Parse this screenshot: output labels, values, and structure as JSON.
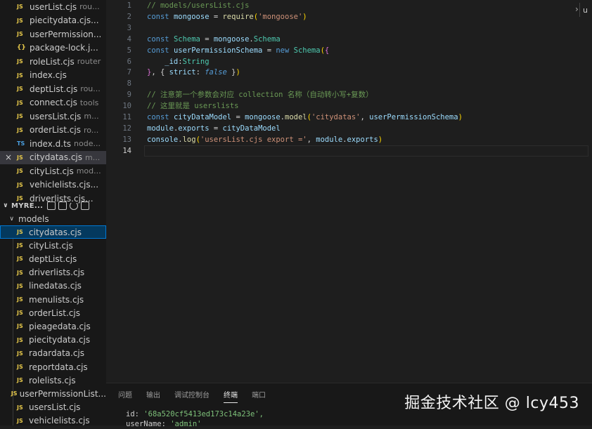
{
  "open_editors": [
    {
      "name": "userList.cjs",
      "desc": "rou...",
      "icon": "JS"
    },
    {
      "name": "piecitydata.cjs...",
      "desc": "",
      "icon": "JS"
    },
    {
      "name": "userPermission...",
      "desc": "",
      "icon": "JS"
    },
    {
      "name": "package-lock.j...",
      "desc": "",
      "icon": "{}"
    },
    {
      "name": "roleList.cjs",
      "desc": "router",
      "icon": "JS"
    },
    {
      "name": "index.cjs",
      "desc": "",
      "icon": "JS"
    },
    {
      "name": "deptList.cjs",
      "desc": "rou...",
      "icon": "JS"
    },
    {
      "name": "connect.cjs",
      "desc": "tools",
      "icon": "JS"
    },
    {
      "name": "usersList.cjs",
      "desc": "m...",
      "icon": "JS"
    },
    {
      "name": "orderList.cjs",
      "desc": "ro...",
      "icon": "JS"
    },
    {
      "name": "index.d.ts",
      "desc": "node...",
      "icon": "TS"
    },
    {
      "name": "citydatas.cjs",
      "desc": "m...",
      "icon": "JS",
      "close": "×",
      "active": true
    },
    {
      "name": "cityList.cjs",
      "desc": "mod...",
      "icon": "JS"
    },
    {
      "name": "vehiclelists.cjs...",
      "desc": "",
      "icon": "JS"
    },
    {
      "name": "driverlists.cjs...",
      "desc": "",
      "icon": "JS"
    }
  ],
  "explorer": {
    "root_label": "MYRE...",
    "folder_label": "models",
    "files": [
      "citydatas.cjs",
      "cityList.cjs",
      "deptList.cjs",
      "driverlists.cjs",
      "linedatas.cjs",
      "menulists.cjs",
      "orderList.cjs",
      "pieagedata.cjs",
      "piecitydata.cjs",
      "radardata.cjs",
      "reportdata.cjs",
      "rolelists.cjs",
      "userPermissionList...",
      "usersList.cjs",
      "vehiclelists.cjs"
    ],
    "file_icon": "JS"
  },
  "editor": {
    "current_line": 14,
    "side_tab_label": "u",
    "line_numbers": [
      "1",
      "2",
      "3",
      "4",
      "5",
      "6",
      "7",
      "8",
      "9",
      "10",
      "11",
      "12",
      "13",
      "14"
    ],
    "lines": [
      [
        {
          "t": "// models/usersList.cjs",
          "c": "cm"
        }
      ],
      [
        {
          "t": "const ",
          "c": "kw"
        },
        {
          "t": "mongoose",
          "c": "var"
        },
        {
          "t": " = ",
          "c": "pun"
        },
        {
          "t": "require",
          "c": "fn"
        },
        {
          "t": "(",
          "c": "br1"
        },
        {
          "t": "'mongoose'",
          "c": "str"
        },
        {
          "t": ")",
          "c": "br1"
        }
      ],
      [],
      [
        {
          "t": "const ",
          "c": "kw"
        },
        {
          "t": "Schema",
          "c": "cls"
        },
        {
          "t": " = ",
          "c": "pun"
        },
        {
          "t": "mongoose",
          "c": "var"
        },
        {
          "t": ".",
          "c": "pun"
        },
        {
          "t": "Schema",
          "c": "cls"
        }
      ],
      [
        {
          "t": "const ",
          "c": "kw"
        },
        {
          "t": "userPermissionSchema",
          "c": "var"
        },
        {
          "t": " = ",
          "c": "pun"
        },
        {
          "t": "new ",
          "c": "kw"
        },
        {
          "t": "Schema",
          "c": "cls"
        },
        {
          "t": "(",
          "c": "br1"
        },
        {
          "t": "{",
          "c": "br2"
        }
      ],
      [
        {
          "t": "    _id",
          "c": "prop"
        },
        {
          "t": ":",
          "c": "pun"
        },
        {
          "t": "String",
          "c": "cls"
        }
      ],
      [
        {
          "t": "}",
          "c": "br2"
        },
        {
          "t": ", { ",
          "c": "pun"
        },
        {
          "t": "strict",
          "c": "prop"
        },
        {
          "t": ": ",
          "c": "pun"
        },
        {
          "t": "false",
          "c": "it"
        },
        {
          "t": " }",
          "c": "pun"
        },
        {
          "t": ")",
          "c": "br1"
        }
      ],
      [],
      [
        {
          "t": "// 注意第一个参数会对应 collection 名称（自动转小写+复数）",
          "c": "cm"
        }
      ],
      [
        {
          "t": "// 这里就是 userslists",
          "c": "cm"
        }
      ],
      [
        {
          "t": "const ",
          "c": "kw"
        },
        {
          "t": "cityDataModel",
          "c": "var"
        },
        {
          "t": " = ",
          "c": "pun"
        },
        {
          "t": "mongoose",
          "c": "var"
        },
        {
          "t": ".",
          "c": "pun"
        },
        {
          "t": "model",
          "c": "fn"
        },
        {
          "t": "(",
          "c": "br1"
        },
        {
          "t": "'citydatas'",
          "c": "str"
        },
        {
          "t": ", ",
          "c": "pun"
        },
        {
          "t": "userPermissionSchema",
          "c": "var"
        },
        {
          "t": ")",
          "c": "br1"
        }
      ],
      [
        {
          "t": "module",
          "c": "var"
        },
        {
          "t": ".",
          "c": "pun"
        },
        {
          "t": "exports",
          "c": "var"
        },
        {
          "t": " = ",
          "c": "pun"
        },
        {
          "t": "cityDataModel",
          "c": "var"
        }
      ],
      [
        {
          "t": "console",
          "c": "var"
        },
        {
          "t": ".",
          "c": "pun"
        },
        {
          "t": "log",
          "c": "fn"
        },
        {
          "t": "(",
          "c": "br1"
        },
        {
          "t": "'usersList.cjs export ='",
          "c": "str"
        },
        {
          "t": ", ",
          "c": "pun"
        },
        {
          "t": "module",
          "c": "var"
        },
        {
          "t": ".",
          "c": "pun"
        },
        {
          "t": "exports",
          "c": "var"
        },
        {
          "t": ")",
          "c": "br1"
        }
      ],
      []
    ]
  },
  "panel": {
    "tabs": [
      "问题",
      "输出",
      "调试控制台",
      "终端",
      "端口"
    ],
    "active_tab": "终端",
    "terminal": {
      "line1_key": "id: ",
      "line1_val": "'68a520cf5413ed173c14a23e',",
      "line2_key": "userName: ",
      "line2_val": "'admin'"
    }
  },
  "watermark": "掘金技术社区 @ lcy453",
  "colors": {
    "selection_outline": "#0078d4",
    "js_icon": "#e6c84a",
    "ts_icon": "#4a9fe0",
    "comment": "#6a9955",
    "string": "#ce9178",
    "keyword": "#569cd6"
  }
}
